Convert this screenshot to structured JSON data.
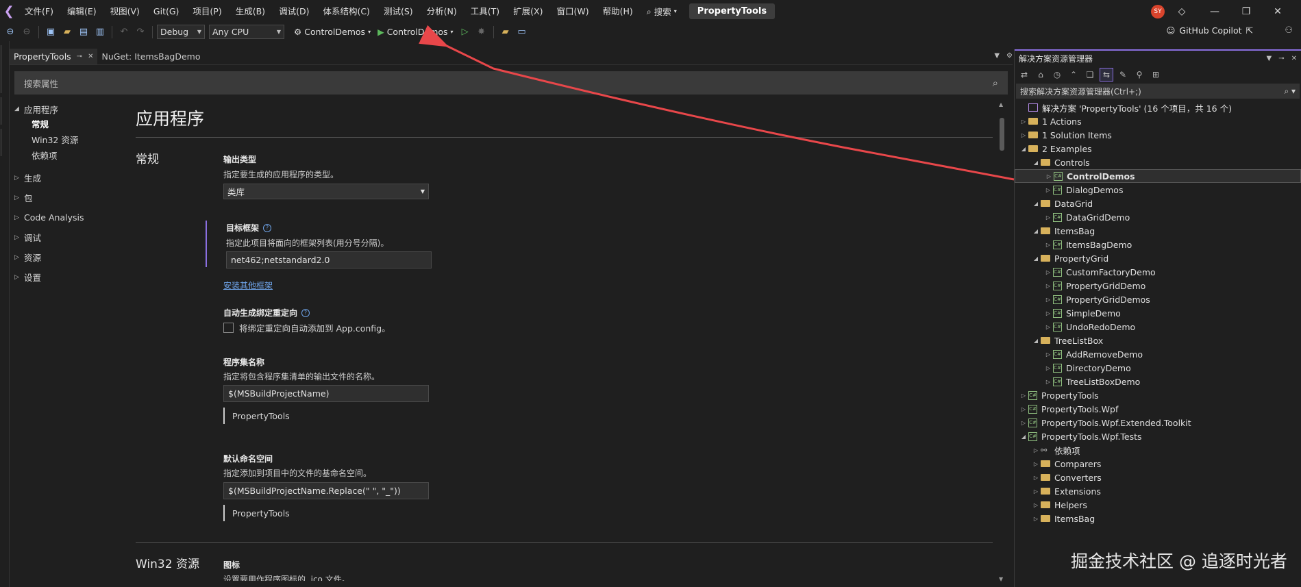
{
  "menubar": {
    "items": [
      "文件(F)",
      "编辑(E)",
      "视图(V)",
      "Git(G)",
      "项目(P)",
      "生成(B)",
      "调试(D)",
      "体系结构(C)",
      "测试(S)",
      "分析(N)",
      "工具(T)",
      "扩展(X)",
      "窗口(W)",
      "帮助(H)"
    ],
    "search": "搜索",
    "project_title": "PropertyTools",
    "avatar": "SY"
  },
  "toolbar": {
    "config": "Debug",
    "platform": "Any CPU",
    "startup_project": "ControlDemos",
    "start_label": "ControlDemos",
    "copilot": "GitHub Copilot"
  },
  "tabs": [
    {
      "label": "PropertyTools"
    },
    {
      "label": "NuGet: ItemsBagDemo"
    }
  ],
  "properties": {
    "search_placeholder": "搜索属性",
    "nav": [
      {
        "label": "应用程序",
        "expanded": true,
        "children": [
          "常规",
          "Win32 资源",
          "依赖项"
        ]
      },
      {
        "label": "生成"
      },
      {
        "label": "包"
      },
      {
        "label": "Code Analysis"
      },
      {
        "label": "调试"
      },
      {
        "label": "资源"
      },
      {
        "label": "设置"
      }
    ],
    "page_title": "应用程序",
    "section_general": "常规",
    "output_type_label": "输出类型",
    "output_type_desc": "指定要生成的应用程序的类型。",
    "output_type_value": "类库",
    "target_framework_label": "目标框架",
    "target_framework_desc": "指定此项目将面向的框架列表(用分号分隔)。",
    "target_framework_value": "net462;netstandard2.0",
    "install_frameworks_link": "安装其他框架",
    "auto_binding_label": "自动生成绑定重定向",
    "auto_binding_checkbox": "将绑定重定向自动添加到 App.config。",
    "assembly_name_label": "程序集名称",
    "assembly_name_desc": "指定将包含程序集清单的输出文件的名称。",
    "assembly_name_value": "$(MSBuildProjectName)",
    "assembly_name_preview": "PropertyTools",
    "default_ns_label": "默认命名空间",
    "default_ns_desc": "指定添加到项目中的文件的基命名空间。",
    "default_ns_value": "$(MSBuildProjectName.Replace(\" \", \"_\"))",
    "default_ns_preview": "PropertyTools",
    "section_win32": "Win32 资源",
    "icon_label": "图标",
    "icon_desc": "设置要用作程序图标的 .ico 文件。"
  },
  "solution_explorer": {
    "title": "解决方案资源管理器",
    "search_placeholder": "搜索解决方案资源管理器(Ctrl+;)",
    "tree": [
      {
        "label": "解决方案 'PropertyTools' (16 个项目，共 16 个)",
        "icon": "solution",
        "depth": 0,
        "exp": ""
      },
      {
        "label": "1 Actions",
        "icon": "folder",
        "depth": 0,
        "exp": "collapsed"
      },
      {
        "label": "1 Solution Items",
        "icon": "folder",
        "depth": 0,
        "exp": "collapsed"
      },
      {
        "label": "2 Examples",
        "icon": "folder",
        "depth": 0,
        "exp": "expanded"
      },
      {
        "label": "Controls",
        "icon": "folder",
        "depth": 1,
        "exp": "expanded"
      },
      {
        "label": "ControlDemos",
        "icon": "csproj",
        "depth": 2,
        "exp": "collapsed",
        "selected": true
      },
      {
        "label": "DialogDemos",
        "icon": "csproj",
        "depth": 2,
        "exp": "collapsed"
      },
      {
        "label": "DataGrid",
        "icon": "folder",
        "depth": 1,
        "exp": "expanded"
      },
      {
        "label": "DataGridDemo",
        "icon": "csproj",
        "depth": 2,
        "exp": "collapsed"
      },
      {
        "label": "ItemsBag",
        "icon": "folder",
        "depth": 1,
        "exp": "expanded"
      },
      {
        "label": "ItemsBagDemo",
        "icon": "csproj",
        "depth": 2,
        "exp": "collapsed"
      },
      {
        "label": "PropertyGrid",
        "icon": "folder",
        "depth": 1,
        "exp": "expanded"
      },
      {
        "label": "CustomFactoryDemo",
        "icon": "csproj",
        "depth": 2,
        "exp": "collapsed"
      },
      {
        "label": "PropertyGridDemo",
        "icon": "csproj",
        "depth": 2,
        "exp": "collapsed"
      },
      {
        "label": "PropertyGridDemos",
        "icon": "csproj",
        "depth": 2,
        "exp": "collapsed"
      },
      {
        "label": "SimpleDemo",
        "icon": "csproj",
        "depth": 2,
        "exp": "collapsed"
      },
      {
        "label": "UndoRedoDemo",
        "icon": "csproj",
        "depth": 2,
        "exp": "collapsed"
      },
      {
        "label": "TreeListBox",
        "icon": "folder",
        "depth": 1,
        "exp": "expanded"
      },
      {
        "label": "AddRemoveDemo",
        "icon": "csproj",
        "depth": 2,
        "exp": "collapsed"
      },
      {
        "label": "DirectoryDemo",
        "icon": "csproj",
        "depth": 2,
        "exp": "collapsed"
      },
      {
        "label": "TreeListBoxDemo",
        "icon": "csproj",
        "depth": 2,
        "exp": "collapsed"
      },
      {
        "label": "PropertyTools",
        "icon": "csproj",
        "depth": 0,
        "exp": "collapsed"
      },
      {
        "label": "PropertyTools.Wpf",
        "icon": "csproj",
        "depth": 0,
        "exp": "collapsed"
      },
      {
        "label": "PropertyTools.Wpf.Extended.Toolkit",
        "icon": "csproj",
        "depth": 0,
        "exp": "collapsed"
      },
      {
        "label": "PropertyTools.Wpf.Tests",
        "icon": "csproj",
        "depth": 0,
        "exp": "expanded"
      },
      {
        "label": "依赖项",
        "icon": "deps",
        "depth": 1,
        "exp": "collapsed"
      },
      {
        "label": "Comparers",
        "icon": "folder",
        "depth": 1,
        "exp": "collapsed"
      },
      {
        "label": "Converters",
        "icon": "folder",
        "depth": 1,
        "exp": "collapsed"
      },
      {
        "label": "Extensions",
        "icon": "folder",
        "depth": 1,
        "exp": "collapsed"
      },
      {
        "label": "Helpers",
        "icon": "folder",
        "depth": 1,
        "exp": "collapsed"
      },
      {
        "label": "ItemsBag",
        "icon": "folder",
        "depth": 1,
        "exp": "collapsed"
      }
    ]
  },
  "watermark": "掘金技术社区 @ 追逐时光者",
  "colors": {
    "accent": "#8a6fe0",
    "arrow": "#e8474a",
    "folder": "#d7b15b"
  }
}
